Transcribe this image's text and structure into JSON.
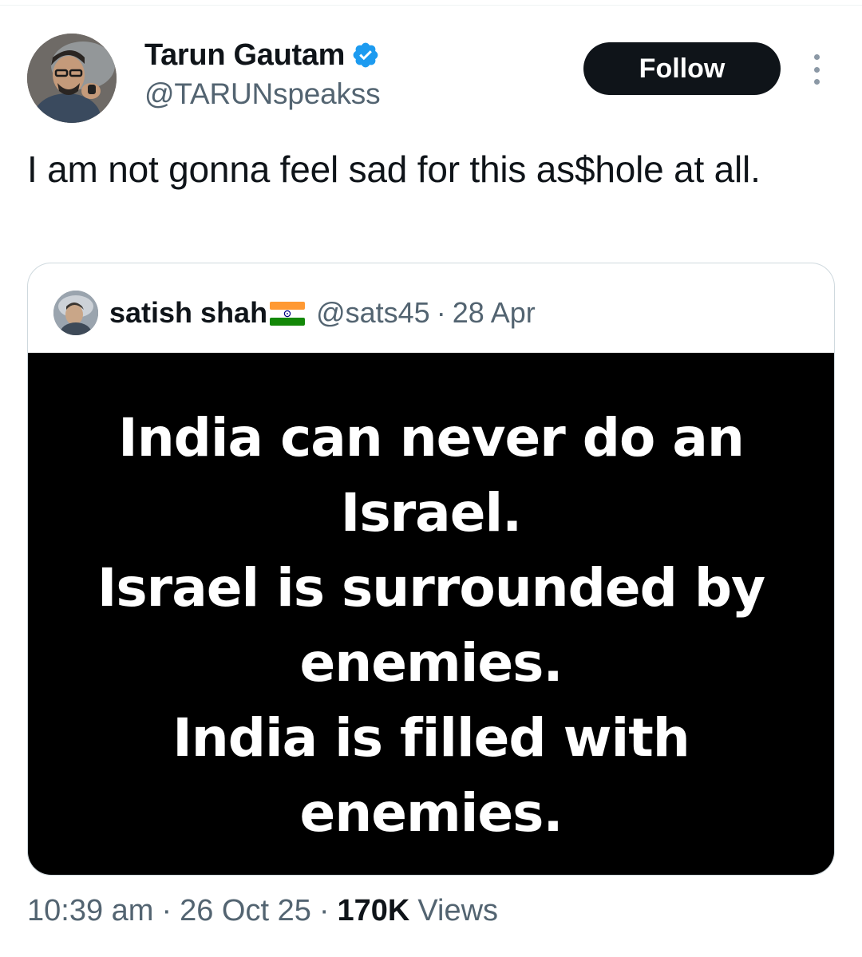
{
  "author": {
    "display_name": "Tarun Gautam",
    "handle": "@TARUNspeakss",
    "verified_icon": "verified-badge-icon",
    "verified_color": "#1d9bf0"
  },
  "actions": {
    "follow_label": "Follow",
    "more_icon": "more-options-icon"
  },
  "tweet": {
    "text": "I am not gonna feel sad for this as$hole at all."
  },
  "quoted_tweet": {
    "display_name": "satish shah",
    "flag_icon": "india-flag-icon",
    "handle": "@sats45",
    "separator": "·",
    "date": "28 Apr",
    "image_text_lines": [
      "India can never do an",
      "Israel.",
      "Israel is surrounded by",
      "enemies.",
      "India is filled with",
      "enemies."
    ]
  },
  "meta": {
    "time": "10:39 am",
    "separator": "·",
    "date": "26 Oct 25",
    "views_count": "170K",
    "views_label": "Views"
  },
  "colors": {
    "text_primary": "#0f1419",
    "text_secondary": "#536471",
    "follow_bg": "#0f1419",
    "border": "#cfd9de"
  }
}
